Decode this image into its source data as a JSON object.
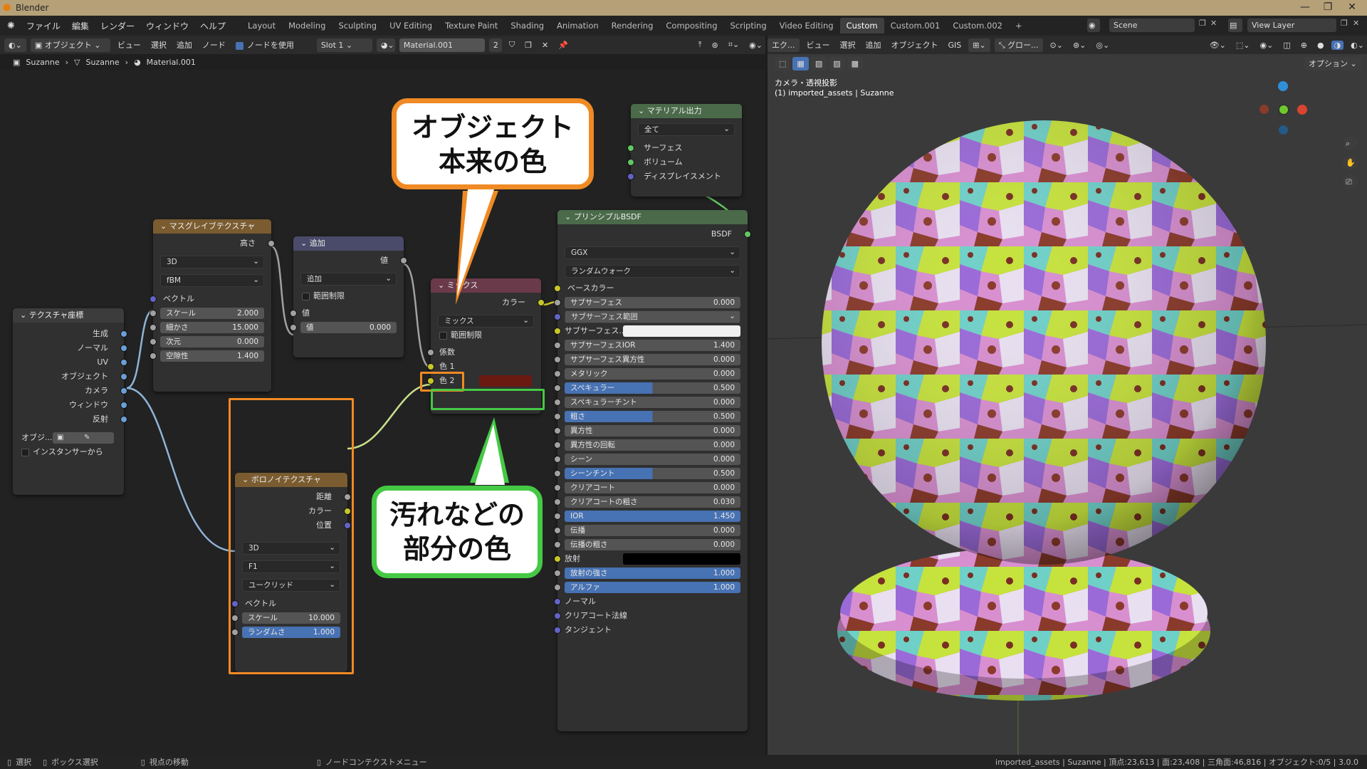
{
  "window": {
    "title": "Blender"
  },
  "menu": [
    "ファイル",
    "編集",
    "レンダー",
    "ウィンドウ",
    "ヘルプ"
  ],
  "workspaces": [
    "Layout",
    "Modeling",
    "Sculpting",
    "UV Editing",
    "Texture Paint",
    "Shading",
    "Animation",
    "Rendering",
    "Compositing",
    "Scripting",
    "Video Editing",
    "Custom",
    "Custom.001",
    "Custom.002"
  ],
  "active_workspace": "Custom",
  "scene": "Scene",
  "view_layer": "View Layer",
  "node_header": {
    "mode": "オブジェクト",
    "view": "ビュー",
    "select": "選択",
    "add": "追加",
    "node": "ノード",
    "use_nodes": "ノードを使用",
    "slot": "Slot 1",
    "material": "Material.001",
    "users": "2"
  },
  "breadcrumb": [
    "Suzanne",
    "Suzanne",
    "Material.001"
  ],
  "viewport_header": {
    "mode": "エク...",
    "view": "ビュー",
    "select": "選択",
    "add": "追加",
    "object": "オブジェクト",
    "gis": "GIS",
    "transform": "グロー...",
    "options": "オプション"
  },
  "viewport_info": {
    "line1": "カメラ・透視投影",
    "line2": "(1) imported_assets | Suzanne"
  },
  "nodes": {
    "texcoord": {
      "title": "テクスチャ座標",
      "outputs": [
        "生成",
        "ノーマル",
        "UV",
        "オブジェクト",
        "カメラ",
        "ウィンドウ",
        "反射"
      ],
      "object_label": "オブジ...",
      "from_instancer": "インスタンサーから"
    },
    "musgrave": {
      "title": "マスグレイブテクスチャ",
      "output": "高さ",
      "dim": "3D",
      "type": "fBM",
      "vector": "ベクトル",
      "fields": [
        {
          "label": "スケール",
          "value": "2.000"
        },
        {
          "label": "細かさ",
          "value": "15.000"
        },
        {
          "label": "次元",
          "value": "0.000"
        },
        {
          "label": "空隙性",
          "value": "1.400"
        }
      ]
    },
    "add": {
      "title": "追加",
      "output": "値",
      "op": "追加",
      "clamp": "範囲制限",
      "input": "値",
      "field": {
        "label": "値",
        "value": "0.000"
      }
    },
    "mix": {
      "title": "ミックス",
      "output": "カラー",
      "blend": "ミックス",
      "clamp": "範囲制限",
      "fac": "係数",
      "color1": "色 1",
      "color2": "色 2"
    },
    "voronoi": {
      "title": "ボロノイテクスチャ",
      "outputs": [
        "距離",
        "カラー",
        "位置"
      ],
      "dim": "3D",
      "feature": "F1",
      "metric": "ユークリッド",
      "vector": "ベクトル",
      "fields": [
        {
          "label": "スケール",
          "value": "10.000"
        },
        {
          "label": "ランダムさ",
          "value": "1.000"
        }
      ]
    },
    "output": {
      "title": "マテリアル出力",
      "target": "全て",
      "inputs": [
        "サーフェス",
        "ボリューム",
        "ディスプレイスメント"
      ]
    },
    "bsdf": {
      "title": "プリンシプルBSDF",
      "output": "BSDF",
      "dist": "GGX",
      "sss_method": "ランダムウォーク",
      "base": "ベースカラー",
      "rows": [
        {
          "label": "サブサーフェス",
          "value": "0.000",
          "type": "field"
        },
        {
          "label": "サブサーフェス範囲",
          "value": "",
          "type": "dd"
        },
        {
          "label": "サブサーフェス...",
          "value": "",
          "type": "color_white"
        },
        {
          "label": "サブサーフェスIOR",
          "value": "1.400",
          "type": "field"
        },
        {
          "label": "サブサーフェス異方性",
          "value": "0.000",
          "type": "field"
        },
        {
          "label": "メタリック",
          "value": "0.000",
          "type": "field"
        },
        {
          "label": "スペキュラー",
          "value": "0.500",
          "type": "slider"
        },
        {
          "label": "スペキュラーチント",
          "value": "0.000",
          "type": "field"
        },
        {
          "label": "粗さ",
          "value": "0.500",
          "type": "slider"
        },
        {
          "label": "異方性",
          "value": "0.000",
          "type": "field"
        },
        {
          "label": "異方性の回転",
          "value": "0.000",
          "type": "field"
        },
        {
          "label": "シーン",
          "value": "0.000",
          "type": "field"
        },
        {
          "label": "シーンチント",
          "value": "0.500",
          "type": "slider"
        },
        {
          "label": "クリアコート",
          "value": "0.000",
          "type": "field"
        },
        {
          "label": "クリアコートの粗さ",
          "value": "0.030",
          "type": "field"
        },
        {
          "label": "IOR",
          "value": "1.450",
          "type": "full"
        },
        {
          "label": "伝播",
          "value": "0.000",
          "type": "field"
        },
        {
          "label": "伝播の粗さ",
          "value": "0.000",
          "type": "field"
        },
        {
          "label": "放射",
          "value": "",
          "type": "color_black"
        },
        {
          "label": "放射の強さ",
          "value": "1.000",
          "type": "full"
        },
        {
          "label": "アルファ",
          "value": "1.000",
          "type": "full"
        },
        {
          "label": "ノーマル",
          "value": "",
          "type": "socket"
        },
        {
          "label": "クリアコート法線",
          "value": "",
          "type": "socket"
        },
        {
          "label": "タンジェント",
          "value": "",
          "type": "socket"
        }
      ]
    }
  },
  "callouts": {
    "top": "オブジェクト\n本来の色",
    "bottom": "汚れなどの\n部分の色"
  },
  "status": {
    "select": "選択",
    "box": "ボックス選択",
    "move": "視点の移動",
    "ctx": "ノードコンテクストメニュー",
    "stats": "imported_assets | Suzanne | 頂点:23,613 | 面:23,408 | 三角面:46,816 | オブジェクト:0/5 | 3.0.0"
  },
  "colors": {
    "orange": "#f08a24",
    "green": "#45c945",
    "mix_color2": "#6b1a12"
  }
}
